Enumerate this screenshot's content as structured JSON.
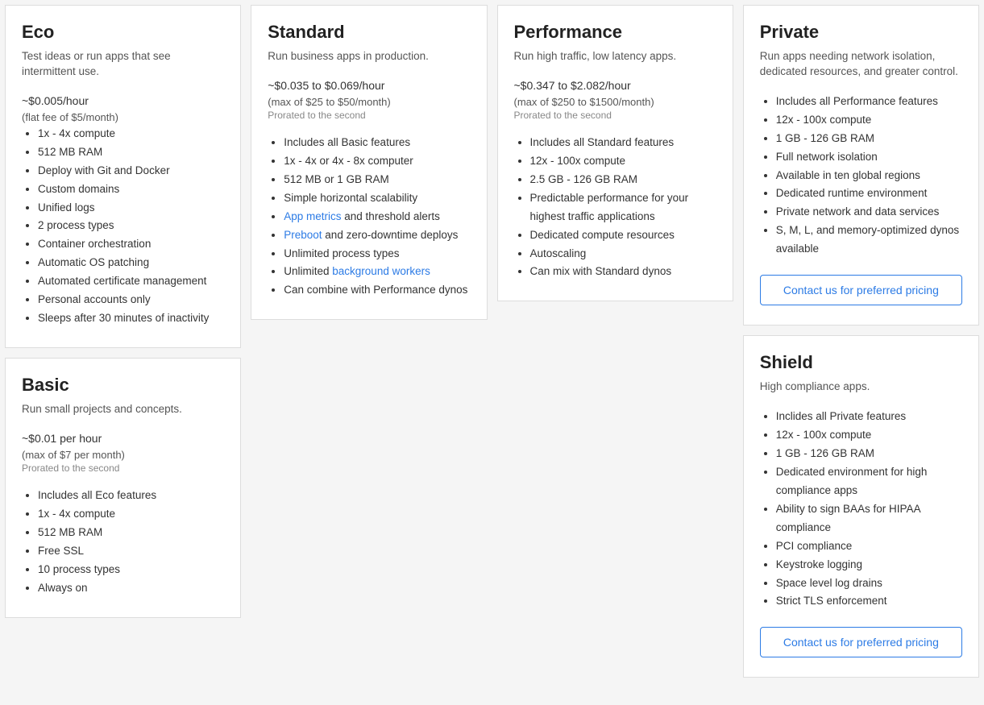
{
  "cards": [
    {
      "col": 0,
      "id": "eco",
      "title": "Eco",
      "subtitle": "Test ideas or run apps that see intermittent use.",
      "price_main": "~$0.005/hour",
      "price_secondary": "(flat fee of $5/month)",
      "price_note": null,
      "features": [
        {
          "text": "1x - 4x compute",
          "link": null
        },
        {
          "text": "512 MB RAM",
          "link": null
        },
        {
          "text": "Deploy with Git and Docker",
          "link": null
        },
        {
          "text": "Custom domains",
          "link": null
        },
        {
          "text": "Unified logs",
          "link": null
        },
        {
          "text": "2 process types",
          "link": null
        },
        {
          "text": "Container orchestration",
          "link": null
        },
        {
          "text": "Automatic OS patching",
          "link": null
        },
        {
          "text": "Automated certificate management",
          "link": null
        },
        {
          "text": "Personal accounts only",
          "link": null
        },
        {
          "text": "Sleeps after 30 minutes of inactivity",
          "link": null
        }
      ],
      "button": null
    },
    {
      "col": 0,
      "id": "basic",
      "title": "Basic",
      "subtitle": "Run small projects and concepts.",
      "price_main": "~$0.01 per hour",
      "price_secondary": "(max of $7 per month)",
      "price_note": "Prorated to the second",
      "features": [
        {
          "text": "Includes all Eco features",
          "link": null
        },
        {
          "text": "1x - 4x compute",
          "link": null
        },
        {
          "text": "512 MB RAM",
          "link": null
        },
        {
          "text": "Free SSL",
          "link": null
        },
        {
          "text": "10 process types",
          "link": null
        },
        {
          "text": "Always on",
          "link": null
        }
      ],
      "button": null
    },
    {
      "col": 1,
      "id": "standard",
      "title": "Standard",
      "subtitle": "Run business apps in production.",
      "price_main": "~$0.035 to $0.069/hour",
      "price_secondary": "(max of $25 to $50/month)",
      "price_note": "Prorated to the second",
      "features": [
        {
          "text": "Includes all Basic features",
          "link": null
        },
        {
          "text": "1x - 4x or 4x - 8x computer",
          "link": null
        },
        {
          "text": "512 MB or 1 GB RAM",
          "link": null
        },
        {
          "text": "Simple horizontal scalability",
          "link": null
        },
        {
          "text_before": "App metrics",
          "link_text": "App metrics",
          "link": "app-metrics",
          "text_after": " and threshold alerts"
        },
        {
          "text_before": "",
          "link_text": "Preboot",
          "link": "preboot",
          "text_after": " and zero-downtime deploys"
        },
        {
          "text": "Unlimited process types",
          "link": null
        },
        {
          "text_before": "Unlimited ",
          "link_text": "background workers",
          "link": "background-workers",
          "text_after": ""
        },
        {
          "text": "Can combine with Performance dynos",
          "link": null
        }
      ],
      "button": null
    },
    {
      "col": 2,
      "id": "performance",
      "title": "Performance",
      "subtitle": "Run high traffic, low latency apps.",
      "price_main": "~$0.347 to $2.082/hour",
      "price_secondary": "(max of $250 to $1500/month)",
      "price_note": "Prorated to the second",
      "features": [
        {
          "text": "Includes all Standard features",
          "link": null
        },
        {
          "text": "12x - 100x compute",
          "link": null
        },
        {
          "text": "2.5 GB - 126 GB RAM",
          "link": null
        },
        {
          "text": "Predictable performance for your highest traffic applications",
          "link": null
        },
        {
          "text": "Dedicated compute resources",
          "link": null
        },
        {
          "text": "Autoscaling",
          "link": null
        },
        {
          "text": "Can mix with Standard dynos",
          "link": null
        }
      ],
      "button": null
    },
    {
      "col": 3,
      "id": "private",
      "title": "Private",
      "subtitle": "Run apps needing network isolation, dedicated resources, and greater control.",
      "price_main": null,
      "price_secondary": null,
      "price_note": null,
      "features": [
        {
          "text": "Includes all Performance features",
          "link": null
        },
        {
          "text": "12x - 100x compute",
          "link": null
        },
        {
          "text": "1 GB - 126 GB RAM",
          "link": null
        },
        {
          "text": "Full network isolation",
          "link": null
        },
        {
          "text": "Available in ten global regions",
          "link": null
        },
        {
          "text": "Dedicated runtime environment",
          "link": null
        },
        {
          "text": "Private network and data services",
          "link": null
        },
        {
          "text": "S, M, L, and memory-optimized dynos available",
          "link": null
        }
      ],
      "button": "Contact us for preferred pricing"
    },
    {
      "col": 3,
      "id": "shield",
      "title": "Shield",
      "subtitle": "High compliance apps.",
      "price_main": null,
      "price_secondary": null,
      "price_note": null,
      "features": [
        {
          "text": "Inclides all Private features",
          "link": null
        },
        {
          "text": "12x - 100x compute",
          "link": null
        },
        {
          "text": "1 GB - 126 GB RAM",
          "link": null
        },
        {
          "text": "Dedicated environment for high compliance apps",
          "link": null
        },
        {
          "text": "Ability to sign BAAs for HIPAA compliance",
          "link": null
        },
        {
          "text": "PCI compliance",
          "link": null
        },
        {
          "text": "Keystroke logging",
          "link": null
        },
        {
          "text": "Space level log drains",
          "link": null
        },
        {
          "text": "Strict TLS enforcement",
          "link": null
        }
      ],
      "button": "Contact us for preferred pricing"
    }
  ],
  "links": {
    "app_metrics_label": "App metrics",
    "preboot_label": "Preboot",
    "background_workers_label": "background workers"
  }
}
